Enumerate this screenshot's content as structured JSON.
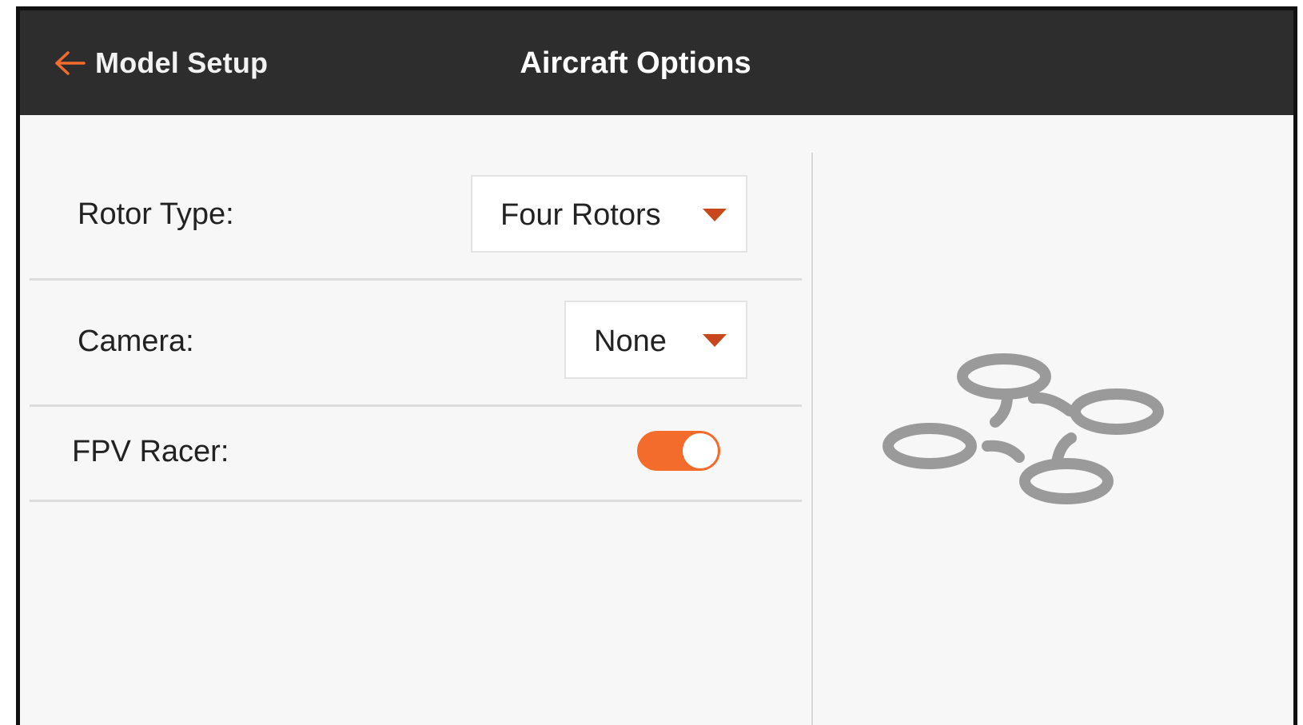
{
  "header": {
    "back_label": "Model Setup",
    "title": "Aircraft Options",
    "accent_color": "#f46c2c",
    "background_color": "#2d2d2d"
  },
  "settings": {
    "rotor_type": {
      "label": "Rotor Type:",
      "value": "Four Rotors"
    },
    "camera": {
      "label": "Camera:",
      "value": "None"
    },
    "fpv_racer": {
      "label": "FPV Racer:",
      "enabled": true
    }
  },
  "preview": {
    "icon": "quadcopter-icon"
  }
}
